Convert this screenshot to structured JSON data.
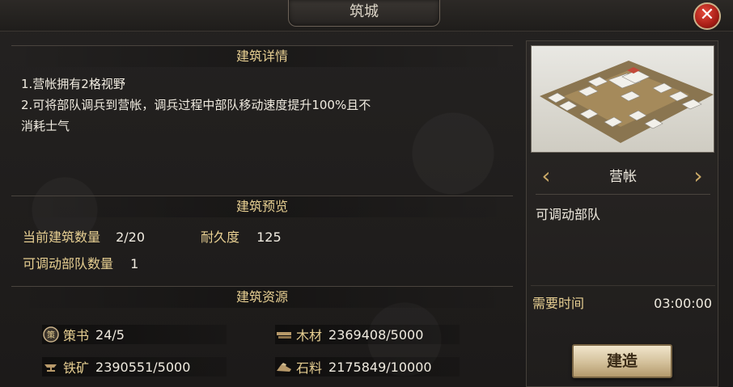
{
  "window": {
    "title": "筑城",
    "close_icon": "close-icon"
  },
  "details": {
    "header": "建筑详情",
    "lines": [
      "1.营帐拥有2格视野",
      "2.可将部队调兵到营帐，调兵过程中部队移动速度提升100%且不",
      "消耗士气"
    ]
  },
  "preview": {
    "header": "建筑预览",
    "build_count_label": "当前建筑数量",
    "build_count_value": "2/20",
    "durability_label": "耐久度",
    "durability_value": "125",
    "troops_label": "可调动部队数量",
    "troops_value": "1"
  },
  "resources": {
    "header": "建筑资源",
    "items": [
      {
        "icon": "strategy-book-icon",
        "name": "策书",
        "value": "24/5"
      },
      {
        "icon": "wood-icon",
        "name": "木材",
        "value": "2369408/5000"
      },
      {
        "icon": "iron-anvil-icon",
        "name": "铁矿",
        "value": "2390551/5000"
      },
      {
        "icon": "stone-icon",
        "name": "石料",
        "value": "2175849/10000"
      }
    ]
  },
  "building": {
    "name": "营帐",
    "description": "可调动部队",
    "time_label": "需要时间",
    "time_value": "03:00:00",
    "build_button": "建造"
  },
  "colors": {
    "gold": "#e7cf92",
    "accent_red": "#a81e16",
    "panel_bg": "#1d1b1a"
  }
}
